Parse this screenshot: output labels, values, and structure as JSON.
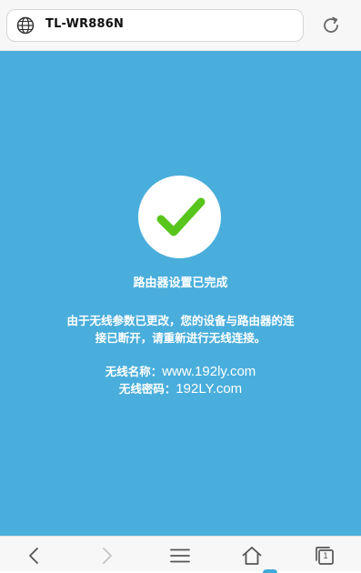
{
  "browser": {
    "address_text": "TL-WR886N",
    "icons": {
      "site": "globe-icon",
      "reload": "reload-icon"
    }
  },
  "content": {
    "status_title": "路由器设置已完成",
    "message_line1": "由于无线参数已更改，您的设备与路由器的连",
    "message_line2": "接已断开，请重新进行无线连接。",
    "ssid_label": "无线名称：",
    "ssid_value": "www.192ly.com",
    "password_label": "无线密码：",
    "password_value": "192LY.com",
    "icon": "check-icon"
  },
  "toolbar": {
    "tab_count": "1",
    "icons": [
      "back-icon",
      "forward-icon",
      "menu-icon",
      "home-icon",
      "tabs-icon"
    ]
  },
  "colors": {
    "background": "#4aaedc",
    "check": "#58c51d",
    "chrome": "#f7f7f7"
  }
}
